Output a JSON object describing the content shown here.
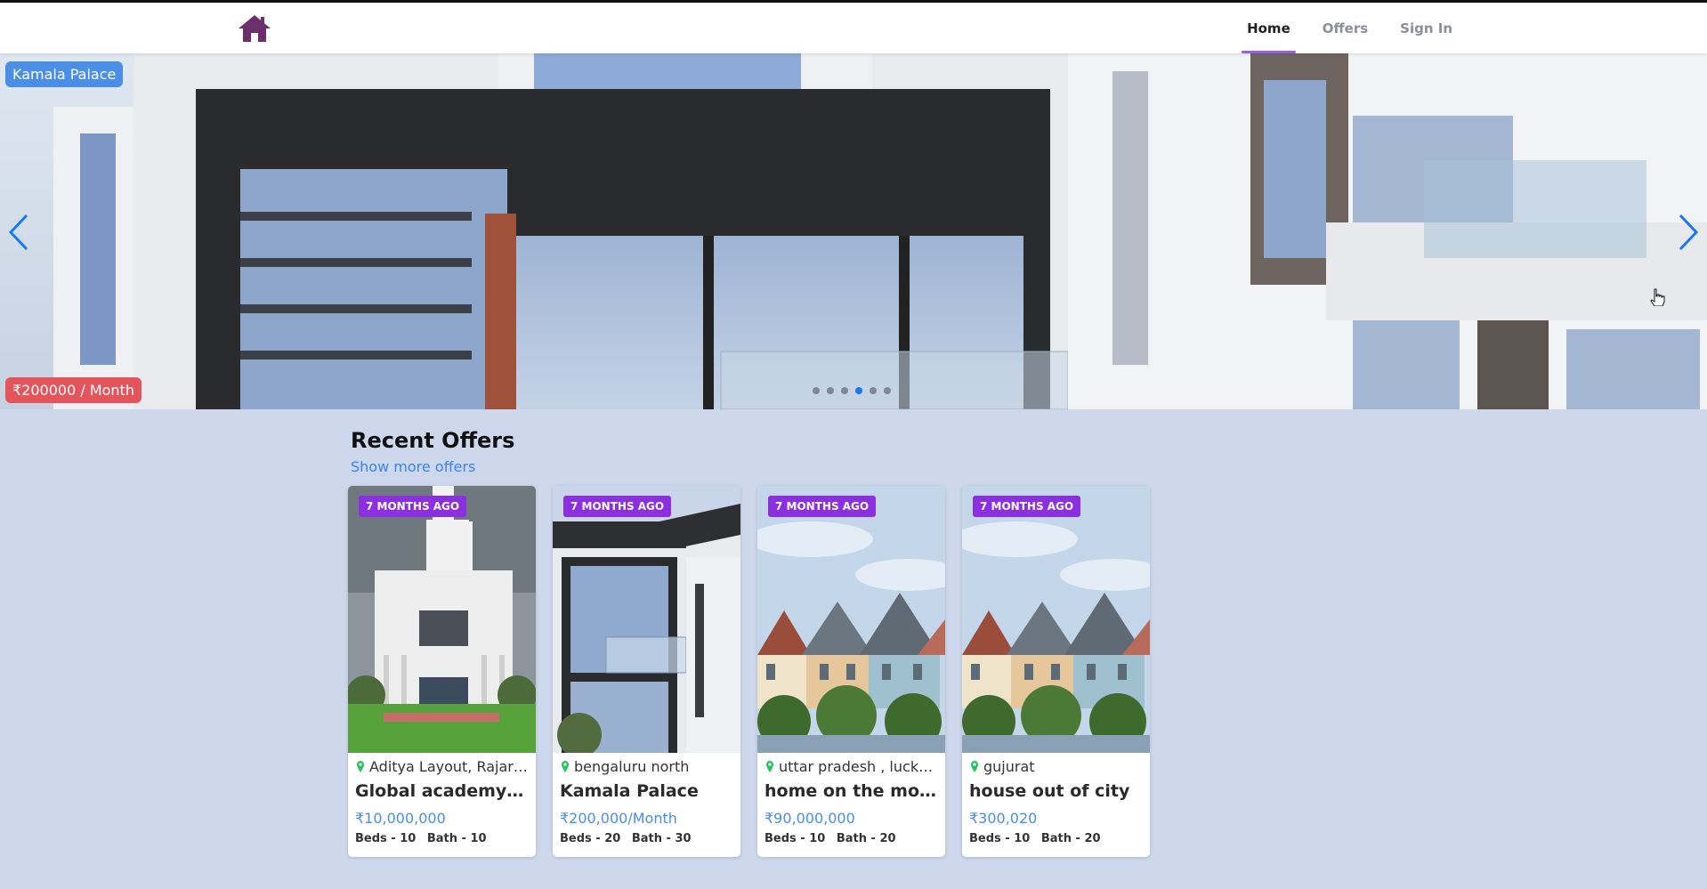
{
  "nav": {
    "logo_icon": "home-icon",
    "items": [
      {
        "label": "Home",
        "active": true
      },
      {
        "label": "Offers",
        "active": false
      },
      {
        "label": "Sign In",
        "active": false
      }
    ]
  },
  "hero": {
    "title": "Kamala Palace",
    "price": "₹200000 / Month",
    "slide_count": 6,
    "active_slide": 4
  },
  "offers": {
    "heading": "Recent Offers",
    "show_more": "Show more offers",
    "cards": [
      {
        "badge": "7 MONTHS AGO",
        "location": "Aditya Layout, Rajaraj...",
        "name": "Global academy of t...",
        "price": "₹10,000,000",
        "beds": "Beds - 10",
        "baths": "Bath - 10"
      },
      {
        "badge": "7 MONTHS AGO",
        "location": "bengaluru north",
        "name": "Kamala Palace",
        "price": "₹200,000/Month",
        "beds": "Beds - 20",
        "baths": "Bath - 30"
      },
      {
        "badge": "7 MONTHS AGO",
        "location": "uttar pradesh , luckn...",
        "name": "home on the mount...",
        "price": "₹90,000,000",
        "beds": "Beds - 10",
        "baths": "Bath - 20"
      },
      {
        "badge": "7 MONTHS AGO",
        "location": "gujurat",
        "name": "house out of city",
        "price": "₹300,020",
        "beds": "Beds - 10",
        "baths": "Bath - 20"
      }
    ]
  },
  "colors": {
    "accent": "#9b5de5",
    "badge": "#8b2fe0",
    "link": "#3b82f6",
    "price": "#4a8ee8",
    "page_bg": "#cdd8ec",
    "pin": "#22c55e"
  }
}
